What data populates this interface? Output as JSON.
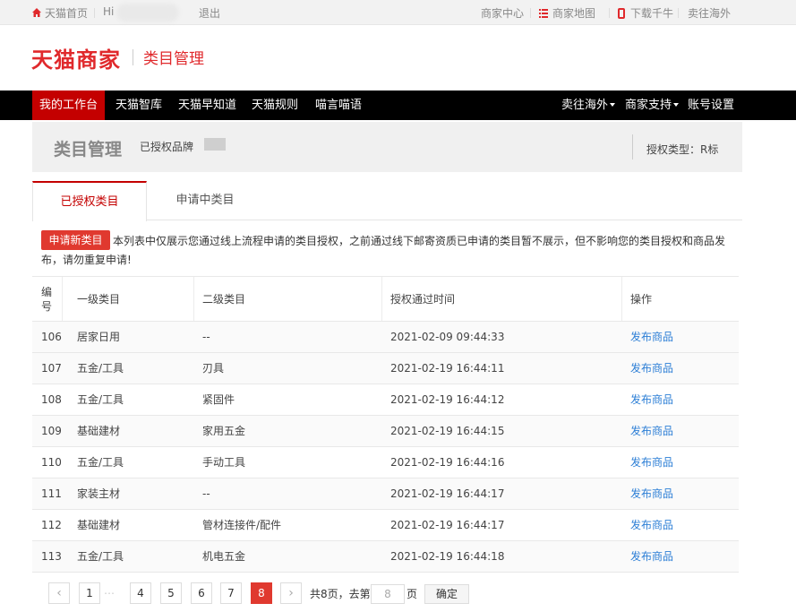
{
  "topbar": {
    "home": "天猫首页",
    "greeting": "Hi",
    "logout": "退出",
    "merchant_center": "商家中心",
    "site_map": "商家地图",
    "download": "下载千牛",
    "overseas": "卖往海外"
  },
  "brand": {
    "logo": "天猫商家",
    "subtitle": "类目管理"
  },
  "nav": {
    "items": [
      "我的工作台",
      "天猫智库",
      "天猫早知道",
      "天猫规则",
      "喵言喵语"
    ],
    "right": [
      "卖往海外",
      "商家支持",
      "账号设置"
    ]
  },
  "page_header": {
    "title": "类目管理",
    "brand_label": "已授权品牌",
    "auth_type": "授权类型：R标"
  },
  "tabs": [
    "已授权类目",
    "申请中类目"
  ],
  "notice": {
    "button": "申请新类目",
    "text": "本列表中仅展示您通过线上流程申请的类目授权，之前通过线下邮寄资质已申请的类目暂不展示，但不影响您的类目授权和商品发布，请勿重复申请!"
  },
  "table": {
    "headers": [
      "编号",
      "一级类目",
      "二级类目",
      "授权通过时间",
      "操作"
    ],
    "rows": [
      {
        "id": "106",
        "cat1": "居家日用",
        "cat2": "--",
        "time": "2021-02-09 09:44:33",
        "action": "发布商品"
      },
      {
        "id": "107",
        "cat1": "五金/工具",
        "cat2": "刃具",
        "time": "2021-02-19 16:44:11",
        "action": "发布商品"
      },
      {
        "id": "108",
        "cat1": "五金/工具",
        "cat2": "紧固件",
        "time": "2021-02-19 16:44:12",
        "action": "发布商品"
      },
      {
        "id": "109",
        "cat1": "基础建材",
        "cat2": "家用五金",
        "time": "2021-02-19 16:44:15",
        "action": "发布商品"
      },
      {
        "id": "110",
        "cat1": "五金/工具",
        "cat2": "手动工具",
        "time": "2021-02-19 16:44:16",
        "action": "发布商品"
      },
      {
        "id": "111",
        "cat1": "家装主材",
        "cat2": "--",
        "time": "2021-02-19 16:44:17",
        "action": "发布商品"
      },
      {
        "id": "112",
        "cat1": "基础建材",
        "cat2": "管材连接件/配件",
        "time": "2021-02-19 16:44:17",
        "action": "发布商品"
      },
      {
        "id": "113",
        "cat1": "五金/工具",
        "cat2": "机电五金",
        "time": "2021-02-19 16:44:18",
        "action": "发布商品"
      }
    ]
  },
  "pagination": {
    "prev": "‹",
    "pages": [
      "1",
      "4",
      "5",
      "6",
      "7",
      "8"
    ],
    "dots": "…",
    "current": "8",
    "next": "›",
    "total_text": "共8页，去第",
    "goto_value": "8",
    "page_unit": "页",
    "confirm": "确定"
  },
  "colors": {
    "brand_red": "#e0292c",
    "nav_active": "#c40000",
    "link_blue": "#2d7fd6"
  }
}
